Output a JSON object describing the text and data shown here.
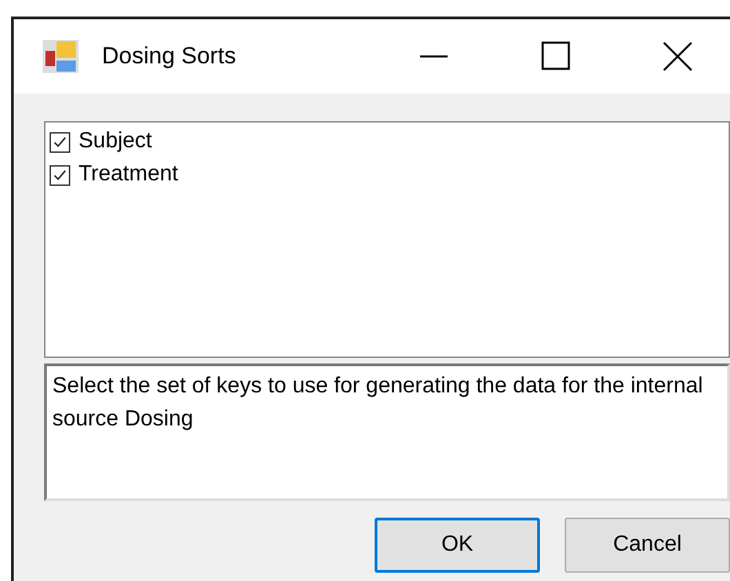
{
  "window": {
    "title": "Dosing Sorts"
  },
  "keys": [
    {
      "label": "Subject",
      "checked": true
    },
    {
      "label": "Treatment",
      "checked": true
    }
  ],
  "description": "Select the set of keys to use for generating the data for the internal source Dosing",
  "buttons": [
    {
      "label": "OK",
      "kind": "default"
    },
    {
      "label": "Cancel",
      "kind": "normal"
    }
  ]
}
